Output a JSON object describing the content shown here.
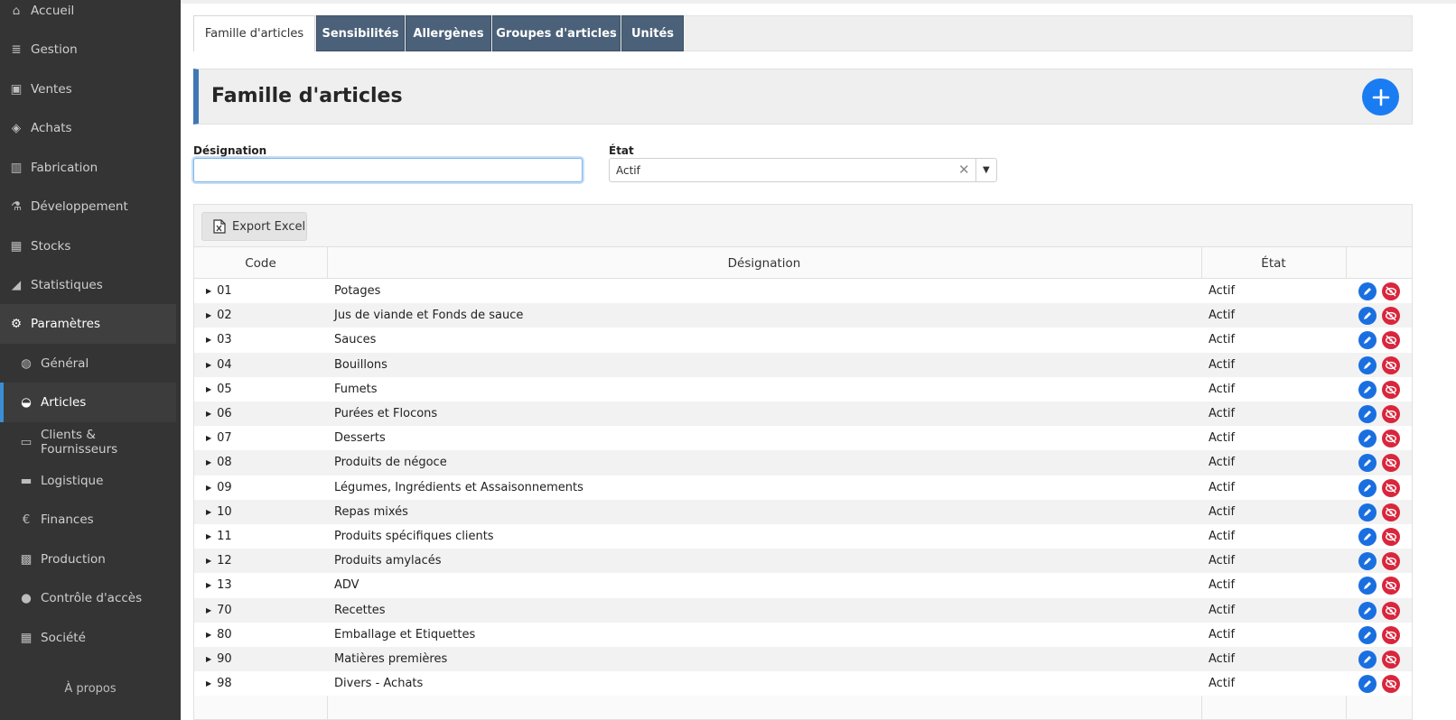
{
  "sidebar": {
    "items": [
      {
        "label": "Accueil",
        "icon": "home-icon",
        "name": "sidebar-item-accueil"
      },
      {
        "label": "Gestion",
        "icon": "database-icon",
        "name": "sidebar-item-gestion"
      },
      {
        "label": "Ventes",
        "icon": "money-icon",
        "name": "sidebar-item-ventes"
      },
      {
        "label": "Achats",
        "icon": "tags-icon",
        "name": "sidebar-item-achats"
      },
      {
        "label": "Fabrication",
        "icon": "industry-icon",
        "name": "sidebar-item-fabrication"
      },
      {
        "label": "Développement",
        "icon": "flask-icon",
        "name": "sidebar-item-developpement"
      },
      {
        "label": "Stocks",
        "icon": "barcode-icon",
        "name": "sidebar-item-stocks"
      },
      {
        "label": "Statistiques",
        "icon": "chart-area-icon",
        "name": "sidebar-item-statistiques"
      },
      {
        "label": "Paramètres",
        "icon": "gear-icon",
        "name": "sidebar-item-parametres"
      },
      {
        "label": "Général",
        "icon": "globe-icon",
        "name": "sidebar-item-general"
      },
      {
        "label": "Articles",
        "icon": "basket-icon",
        "name": "sidebar-item-articles"
      },
      {
        "label": "Clients & Fournisseurs",
        "icon": "folder-icon",
        "name": "sidebar-item-clients-fournisseurs"
      },
      {
        "label": "Logistique",
        "icon": "truck-icon",
        "name": "sidebar-item-logistique"
      },
      {
        "label": "Finances",
        "icon": "euro-icon",
        "name": "sidebar-item-finances"
      },
      {
        "label": "Production",
        "icon": "production-icon",
        "name": "sidebar-item-production"
      },
      {
        "label": "Contrôle d'accès",
        "icon": "user-key-icon",
        "name": "sidebar-item-controle-acces"
      },
      {
        "label": "Société",
        "icon": "building-icon",
        "name": "sidebar-item-societe"
      }
    ],
    "apropos": "À propos"
  },
  "tabs": [
    {
      "label": "Famille d'articles"
    },
    {
      "label": "Sensibilités"
    },
    {
      "label": "Allergènes"
    },
    {
      "label": "Groupes d'articles"
    },
    {
      "label": "Unités"
    }
  ],
  "page": {
    "title": "Famille d'articles"
  },
  "filters": {
    "designation_label": "Désignation",
    "designation_value": "",
    "etat_label": "État",
    "etat_value": "Actif",
    "etat_clear": "✕"
  },
  "toolbar": {
    "export_label": "Export Excel"
  },
  "table": {
    "headers": {
      "code": "Code",
      "designation": "Désignation",
      "etat": "État"
    },
    "rows": [
      {
        "code": "01",
        "designation": "Potages",
        "etat": "Actif"
      },
      {
        "code": "02",
        "designation": "Jus de viande et Fonds de sauce",
        "etat": "Actif"
      },
      {
        "code": "03",
        "designation": "Sauces",
        "etat": "Actif"
      },
      {
        "code": "04",
        "designation": "Bouillons",
        "etat": "Actif"
      },
      {
        "code": "05",
        "designation": "Fumets",
        "etat": "Actif"
      },
      {
        "code": "06",
        "designation": "Purées et Flocons",
        "etat": "Actif"
      },
      {
        "code": "07",
        "designation": "Desserts",
        "etat": "Actif"
      },
      {
        "code": "08",
        "designation": "Produits de négoce",
        "etat": "Actif"
      },
      {
        "code": "09",
        "designation": "Légumes, Ingrédients et Assaisonnements",
        "etat": "Actif"
      },
      {
        "code": "10",
        "designation": "Repas mixés",
        "etat": "Actif"
      },
      {
        "code": "11",
        "designation": "Produits spécifiques clients",
        "etat": "Actif"
      },
      {
        "code": "12",
        "designation": "Produits amylacés",
        "etat": "Actif"
      },
      {
        "code": "13",
        "designation": "ADV",
        "etat": "Actif"
      },
      {
        "code": "70",
        "designation": "Recettes",
        "etat": "Actif"
      },
      {
        "code": "80",
        "designation": "Emballage et Etiquettes",
        "etat": "Actif"
      },
      {
        "code": "90",
        "designation": "Matières premières",
        "etat": "Actif"
      },
      {
        "code": "98",
        "designation": "Divers - Achats",
        "etat": "Actif"
      }
    ]
  },
  "colors": {
    "accent": "#1a7cf2",
    "danger": "#d9263c",
    "tab": "#4b6179",
    "sidebar": "#343434"
  }
}
